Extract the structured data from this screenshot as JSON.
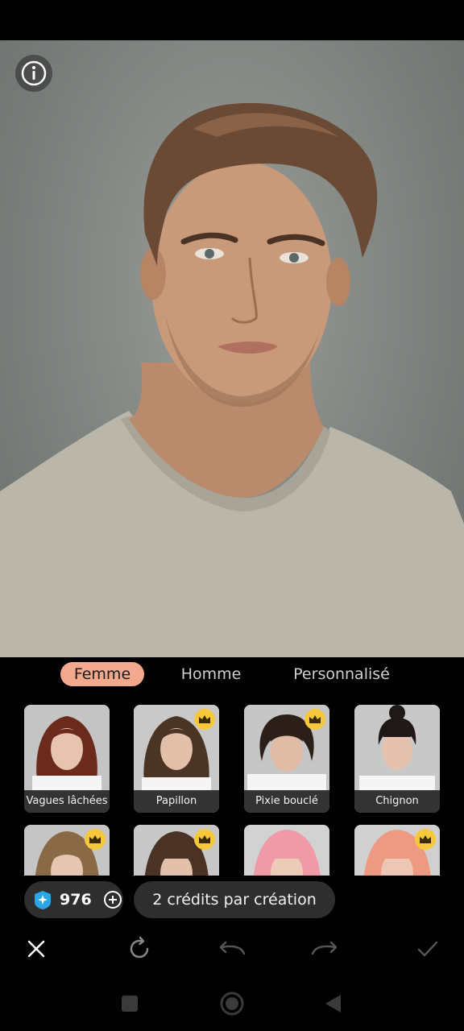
{
  "tabs": [
    {
      "label": "Femme",
      "active": true
    },
    {
      "label": "Homme",
      "active": false
    },
    {
      "label": "Personnalisé",
      "active": false
    }
  ],
  "styles_row1": [
    {
      "label": "Vagues lâchées",
      "premium": false,
      "hair_color": "#6b2a1c"
    },
    {
      "label": "Papillon",
      "premium": true,
      "hair_color": "#4a3424"
    },
    {
      "label": "Pixie bouclé",
      "premium": true,
      "hair_color": "#2c1f1a"
    },
    {
      "label": "Chignon",
      "premium": false,
      "hair_color": "#1e1816"
    }
  ],
  "styles_row2": [
    {
      "premium": true,
      "hair_color": "#8a6a46"
    },
    {
      "premium": true,
      "hair_color": "#4a3324"
    },
    {
      "premium": false,
      "hair_color": "#f09aa8"
    },
    {
      "premium": true,
      "hair_color": "#ee9a82"
    }
  ],
  "credits": {
    "value": "976",
    "icon": "diamond-credit-icon"
  },
  "tooltip": "2 crédits par création",
  "toolbar": [
    "close-icon",
    "regenerate-icon",
    "undo-icon",
    "redo-icon",
    "confirm-icon"
  ],
  "nav": [
    "recents-icon",
    "home-icon",
    "back-icon"
  ],
  "colors": {
    "accent": "#f3a98e",
    "crown": "#f7c93a",
    "panel": "#2e2e2e"
  }
}
